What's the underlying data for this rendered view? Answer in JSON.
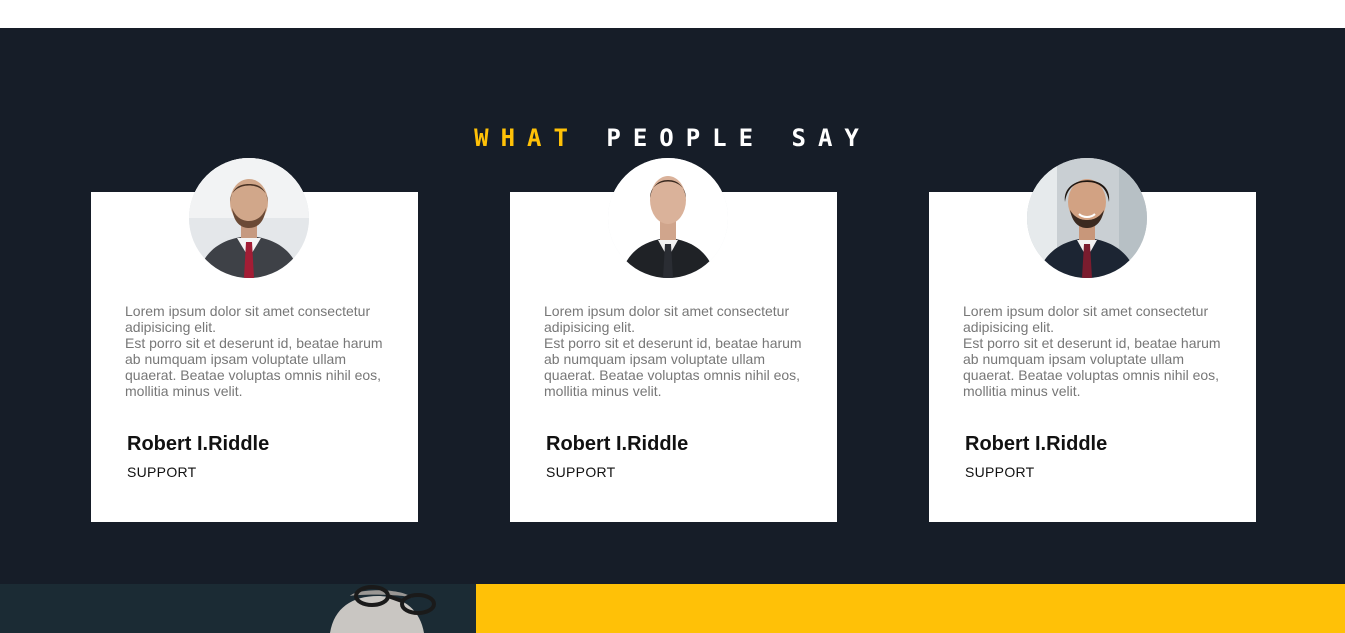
{
  "section": {
    "title_accent": "WHAT",
    "title_rest": "PEOPLE SAY"
  },
  "testimonials": [
    {
      "photo": "man-beard-suit-photo",
      "quote_line1": "Lorem ipsum dolor sit amet consectetur adipisicing elit.",
      "quote_line2": "Est porro sit et deserunt id, beatae harum ab numquam ipsam voluptate ullam quaerat. Beatae voluptas omnis nihil eos, mollitia minus velit.",
      "name": "Robert I.Riddle",
      "role": "SUPPORT"
    },
    {
      "photo": "man-suit-tie-photo",
      "quote_line1": "Lorem ipsum dolor sit amet consectetur adipisicing elit.",
      "quote_line2": "Est porro sit et deserunt id, beatae harum ab numquam ipsam voluptate ullam quaerat. Beatae voluptas omnis nihil eos, mollitia minus velit.",
      "name": "Robert I.Riddle",
      "role": "SUPPORT"
    },
    {
      "photo": "man-curly-hair-smiling-photo",
      "quote_line1": "Lorem ipsum dolor sit amet consectetur adipisicing elit.",
      "quote_line2": "Est porro sit et deserunt id, beatae harum ab numquam ipsam voluptate ullam quaerat. Beatae voluptas omnis nihil eos, mollitia minus velit.",
      "name": "Robert I.Riddle",
      "role": "SUPPORT"
    }
  ],
  "colors": {
    "background_dark": "#161d28",
    "accent_yellow": "#ffc107",
    "card_bg": "#ffffff",
    "quote_text": "#777777"
  }
}
